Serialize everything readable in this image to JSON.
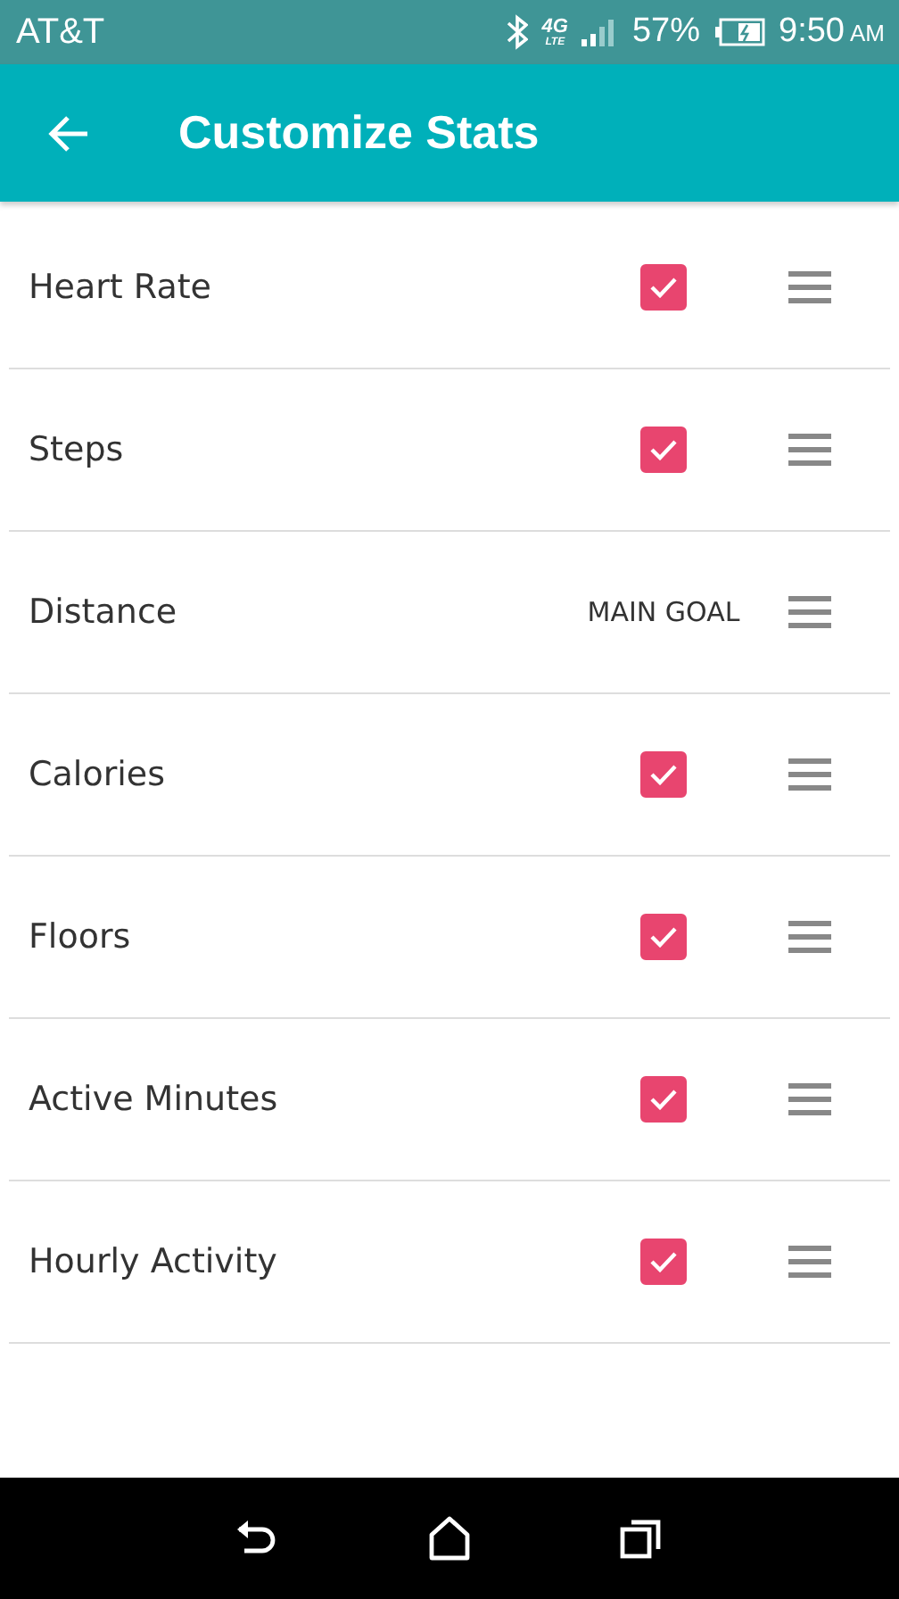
{
  "status_bar": {
    "carrier": "AT&T",
    "network": "4G",
    "network_sub": "LTE",
    "battery": "57%",
    "time": "9:50",
    "meridiem": "AM"
  },
  "app_bar": {
    "title": "Customize Stats"
  },
  "stats": [
    {
      "label": "Heart Rate",
      "kind": "checkbox",
      "checked": true
    },
    {
      "label": "Steps",
      "kind": "checkbox",
      "checked": true
    },
    {
      "label": "Distance",
      "kind": "goal",
      "badge": "MAIN GOAL"
    },
    {
      "label": "Calories",
      "kind": "checkbox",
      "checked": true
    },
    {
      "label": "Floors",
      "kind": "checkbox",
      "checked": true
    },
    {
      "label": "Active Minutes",
      "kind": "checkbox",
      "checked": true
    },
    {
      "label": "Hourly Activity",
      "kind": "checkbox",
      "checked": true
    }
  ]
}
